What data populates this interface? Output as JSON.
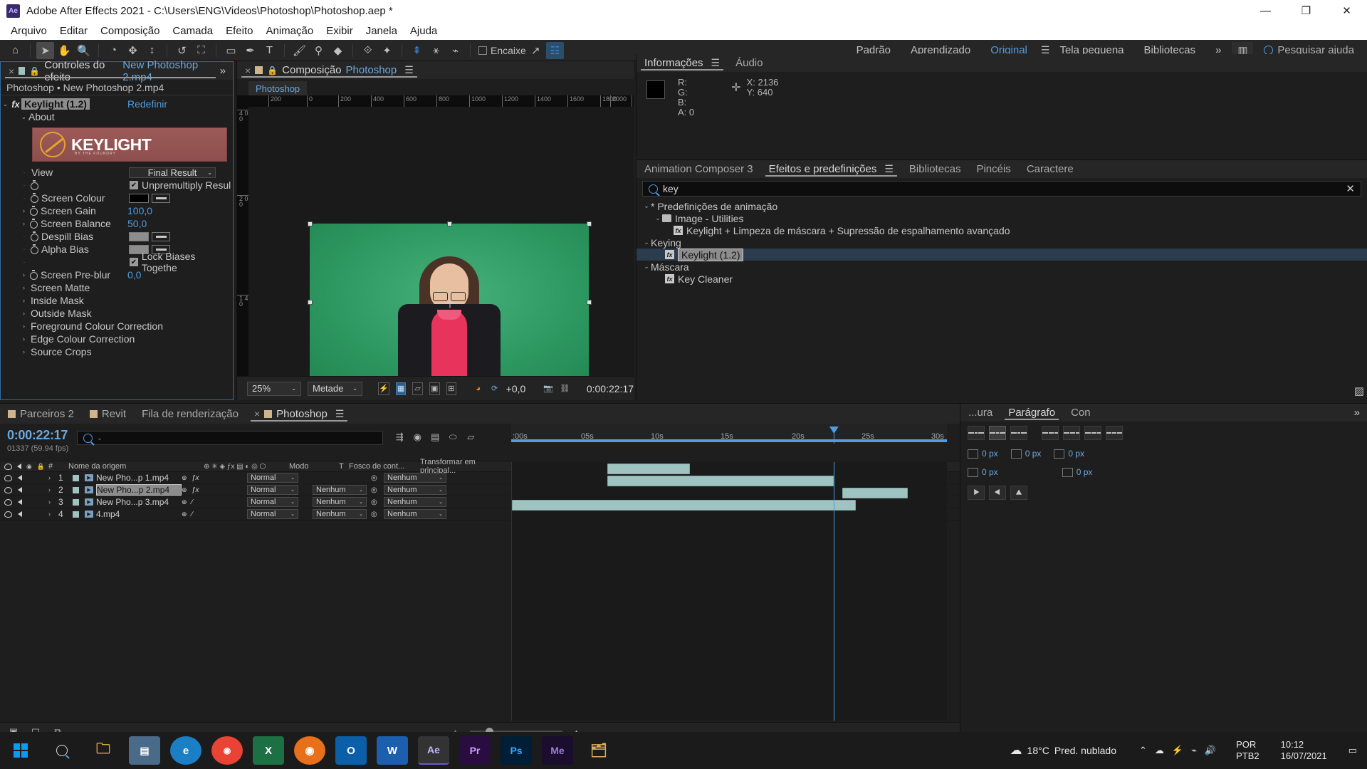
{
  "titlebar": {
    "app_icon": "ae-logo-icon",
    "title": "Adobe After Effects 2021 - C:\\Users\\ENG\\Videos\\Photoshop\\Photoshop.aep *",
    "minimize": "—",
    "maximize": "❐",
    "close": "✕"
  },
  "menu": [
    "Arquivo",
    "Editar",
    "Composição",
    "Camada",
    "Efeito",
    "Animação",
    "Exibir",
    "Janela",
    "Ajuda"
  ],
  "toolbar": {
    "snap_label": "Encaixe",
    "workspaces": [
      "Padrão",
      "Aprendizado",
      "Original",
      "Tela pequena",
      "Bibliotecas"
    ],
    "active_workspace": "Original",
    "overflow": "»",
    "search_placeholder": "Pesquisar ajuda"
  },
  "effect_controls": {
    "tab_label": "Controles do efeito",
    "tab_target": "New Photoshop 2.mp4",
    "breadcrumb": "Photoshop • New Photoshop 2.mp4",
    "effect_name": "Keylight (1.2)",
    "reset_label": "Redefinir",
    "about_label": "About",
    "banner_title": "KEYLIGHT",
    "banner_sub": "BY THE FOUNDRY",
    "params": [
      {
        "label": "View",
        "value": "Final Result",
        "kind": "dropdown"
      },
      {
        "label": "",
        "value": "Unpremultiply Resul",
        "kind": "checkbox",
        "checked": true
      },
      {
        "label": "Screen Colour",
        "value": "#000000",
        "kind": "colour"
      },
      {
        "label": "Screen Gain",
        "value": "100,0",
        "kind": "number"
      },
      {
        "label": "Screen Balance",
        "value": "50,0",
        "kind": "number"
      },
      {
        "label": "Despill Bias",
        "value": "#8d8d8d",
        "kind": "colour"
      },
      {
        "label": "Alpha Bias",
        "value": "#8d8d8d",
        "kind": "colour"
      },
      {
        "label": "",
        "value": "Lock Biases Togethe",
        "kind": "checkbox",
        "checked": true
      },
      {
        "label": "Screen Pre-blur",
        "value": "0,0",
        "kind": "number"
      }
    ],
    "groups": [
      "Screen Matte",
      "Inside Mask",
      "Outside Mask",
      "Foreground Colour Correction",
      "Edge Colour Correction",
      "Source Crops"
    ],
    "overflow": "»"
  },
  "composition": {
    "tab_label": "Composição",
    "tab_name": "Photoshop",
    "breadcrumb": "Photoshop",
    "ruler_top": [
      "200",
      "0",
      "200",
      "400",
      "600",
      "800",
      "1000",
      "1200",
      "1400",
      "1600",
      "1800",
      "2000",
      "220"
    ],
    "ruler_left": [
      "4 0 0",
      "2 0 0",
      "1 4 0"
    ],
    "zoom": "25%",
    "resolution": "Metade",
    "exposure": "+0,0",
    "timecode": "0:00:22:17"
  },
  "info": {
    "tabs": [
      "Informações",
      "Áudio"
    ],
    "active_tab": "Informações",
    "channels": [
      {
        "label": "R:",
        "value": ""
      },
      {
        "label": "G:",
        "value": ""
      },
      {
        "label": "B:",
        "value": ""
      },
      {
        "label": "A:",
        "value": "0"
      }
    ],
    "coords": [
      {
        "label": "X:",
        "value": "2136"
      },
      {
        "label": "Y:",
        "value": "640"
      }
    ]
  },
  "effects_presets": {
    "tabs": [
      "Animation Composer 3",
      "Efeitos e predefinições",
      "Bibliotecas",
      "Pincéis",
      "Caractere"
    ],
    "active_tab": "Efeitos e predefinições",
    "search_value": "key",
    "clear_icon": "✕",
    "tree": [
      {
        "depth": 0,
        "twisty": "⌄",
        "label": "* Predefinições de animação",
        "icon": "none",
        "selected": false
      },
      {
        "depth": 1,
        "twisty": "⌄",
        "label": "Image - Utilities",
        "icon": "folder",
        "selected": false
      },
      {
        "depth": 2,
        "twisty": "",
        "label": "Keylight + Limpeza de máscara + Supressão de espalhamento avançado",
        "icon": "fx",
        "selected": false
      },
      {
        "depth": 0,
        "twisty": "⌄",
        "label": "Keying",
        "icon": "none",
        "selected": false
      },
      {
        "depth": 1,
        "twisty": "",
        "label": "Keylight (1.2)",
        "icon": "fx",
        "selected": true
      },
      {
        "depth": 0,
        "twisty": "⌄",
        "label": "Máscara",
        "icon": "none",
        "selected": false
      },
      {
        "depth": 1,
        "twisty": "",
        "label": "Key Cleaner",
        "icon": "fx",
        "selected": false
      }
    ]
  },
  "timeline": {
    "tabs": [
      "Parceiros 2",
      "Revit",
      "Fila de renderização",
      "Photoshop"
    ],
    "active_tab": "Photoshop",
    "current_time": "0:00:22:17",
    "fps_info": "01337 (59.94 fps)",
    "search_placeholder": "",
    "columns": [
      "#",
      "Nome da origem",
      "Modo",
      "T",
      "Fosco de cont...",
      "Transformar em principal..."
    ],
    "layers": [
      {
        "index": "1",
        "name": "New Pho...p 1.mp4",
        "mode": "Normal",
        "matte": "",
        "parent": "Nenhum",
        "selected": false,
        "has_fx": true
      },
      {
        "index": "2",
        "name": "New Pho...p 2.mp4",
        "mode": "Normal",
        "matte": "Nenhum",
        "parent": "Nenhum",
        "selected": true,
        "has_fx": true
      },
      {
        "index": "3",
        "name": "New Pho...p 3.mp4",
        "mode": "Normal",
        "matte": "Nenhum",
        "parent": "Nenhum",
        "selected": false,
        "has_fx": false
      },
      {
        "index": "4",
        "name": "4.mp4",
        "mode": "Normal",
        "matte": "Nenhum",
        "parent": "Nenhum",
        "selected": false,
        "has_fx": false
      }
    ],
    "time_ticks": [
      ":00s",
      "05s",
      "10s",
      "15s",
      "20s",
      "25s",
      "30s"
    ],
    "bars": [
      {
        "row": 0,
        "left_pct": 22,
        "width_pct": 19
      },
      {
        "row": 1,
        "left_pct": 22,
        "width_pct": 52
      },
      {
        "row": 2,
        "left_pct": 76,
        "width_pct": 15
      },
      {
        "row": 3,
        "left_pct": 0,
        "width_pct": 79
      }
    ],
    "playhead_pct": 74
  },
  "right_dock": {
    "tabs": [
      "...ura",
      "Parágrafo",
      "Con"
    ],
    "active_tab": "Parágrafo",
    "overflow": "»",
    "fields": [
      {
        "icon": "indent-left-icon",
        "value": "0 px"
      },
      {
        "icon": "indent-right-icon",
        "value": "0 px"
      },
      {
        "icon": "indent-first-icon",
        "value": "0 px"
      },
      {
        "icon": "space-before-icon",
        "value": "0 px"
      },
      {
        "icon": "space-after-icon",
        "value": "0 px"
      }
    ]
  },
  "taskbar": {
    "start_icon": "windows-icon",
    "search_icon": "search-icon",
    "apps": [
      {
        "name": "file-explorer",
        "glyph": "📁",
        "color": "#e8b53a"
      },
      {
        "name": "mail-store",
        "glyph": "▤",
        "color": "#5aa0d8"
      },
      {
        "name": "edge-browser",
        "glyph": "e",
        "color": "#2a9bd8"
      },
      {
        "name": "chrome-browser",
        "glyph": "●",
        "color": "#4285f4"
      },
      {
        "name": "excel",
        "glyph": "X",
        "color": "#1d7044"
      },
      {
        "name": "firefox",
        "glyph": "◉",
        "color": "#e8701a"
      },
      {
        "name": "outlook",
        "glyph": "O",
        "color": "#0a5fa8"
      },
      {
        "name": "word",
        "glyph": "W",
        "color": "#1b5fae"
      },
      {
        "name": "after-effects",
        "glyph": "Ae",
        "color": "#3a2a6d"
      },
      {
        "name": "premiere-pro",
        "glyph": "Pr",
        "color": "#3d1a5e"
      },
      {
        "name": "photoshop",
        "glyph": "Ps",
        "color": "#0a2d4d"
      },
      {
        "name": "media-encoder",
        "glyph": "Me",
        "color": "#2a1a4d"
      },
      {
        "name": "explorer-window",
        "glyph": "🗁",
        "color": "#d8b05a"
      }
    ],
    "weather_temp": "18°C",
    "weather_desc": "Pred. nublado",
    "lang1": "POR",
    "lang2": "PTB2",
    "time": "10:12",
    "date": "16/07/2021"
  }
}
